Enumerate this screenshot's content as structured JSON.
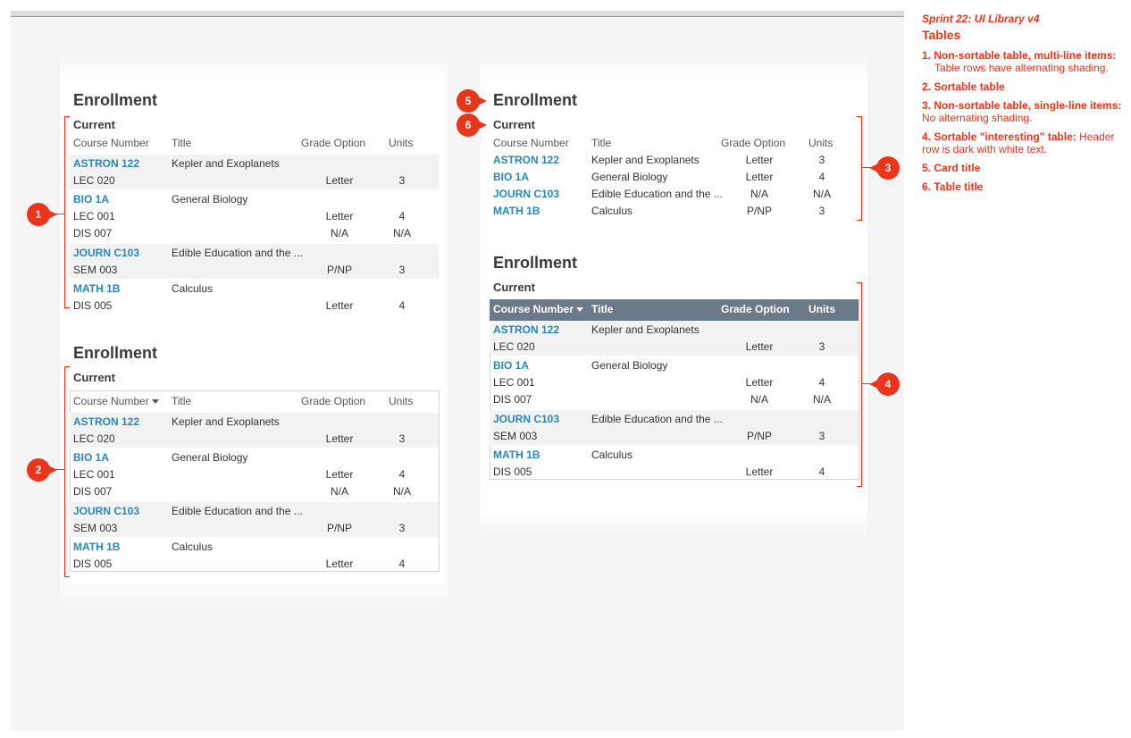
{
  "notes": {
    "sprint": "Sprint 22: UI Library v4",
    "title": "Tables",
    "items": [
      {
        "num": "1.",
        "label": "Non-sortable table, multi-line items:",
        "desc": "Table rows have alternating shading."
      },
      {
        "num": "2.",
        "label": "Sortable table",
        "desc": ""
      },
      {
        "num": "3.",
        "label": "Non-sortable table, single-line items:",
        "desc": "No alternating shading."
      },
      {
        "num": "4.",
        "label": "Sortable \"interesting\" table:",
        "desc": "Header row is dark with white text."
      },
      {
        "num": "5.",
        "label": "Card title",
        "desc": ""
      },
      {
        "num": "6.",
        "label": "Table title",
        "desc": ""
      }
    ]
  },
  "markers": [
    "1",
    "2",
    "3",
    "4",
    "5",
    "6"
  ],
  "card_title": "Enrollment",
  "table_title": "Current",
  "headers": {
    "course": "Course Number",
    "title": "Title",
    "grade": "Grade Option",
    "units": "Units"
  },
  "courses": [
    {
      "course": "ASTRON 122",
      "title": "Kepler and Exoplanets",
      "sections": [
        {
          "section": "LEC 020",
          "grade": "Letter",
          "units": "3"
        }
      ]
    },
    {
      "course": "BIO 1A",
      "title": "General Biology",
      "sections": [
        {
          "section": "LEC 001",
          "grade": "Letter",
          "units": "4"
        },
        {
          "section": "DIS 007",
          "grade": "N/A",
          "units": "N/A"
        }
      ]
    },
    {
      "course": "JOURN C103",
      "title": "Edible Education and the ...",
      "sections": [
        {
          "section": "SEM 003",
          "grade": "P/NP",
          "units": "3"
        }
      ]
    },
    {
      "course": "MATH 1B",
      "title": "Calculus",
      "sections": [
        {
          "section": "DIS 005",
          "grade": "Letter",
          "units": "4"
        }
      ]
    }
  ],
  "single": [
    {
      "course": "ASTRON 122",
      "title": "Kepler and Exoplanets",
      "grade": "Letter",
      "units": "3"
    },
    {
      "course": "BIO 1A",
      "title": "General Biology",
      "grade": "Letter",
      "units": "4"
    },
    {
      "course": "JOURN C103",
      "title": "Edible Education and the ...",
      "grade": "N/A",
      "units": "N/A"
    },
    {
      "course": "MATH 1B",
      "title": "Calculus",
      "grade": "P/NP",
      "units": "3"
    }
  ],
  "colors": {
    "accent": "#e8351b",
    "link": "#2a86b5",
    "dark_header": "#6a7a88"
  }
}
